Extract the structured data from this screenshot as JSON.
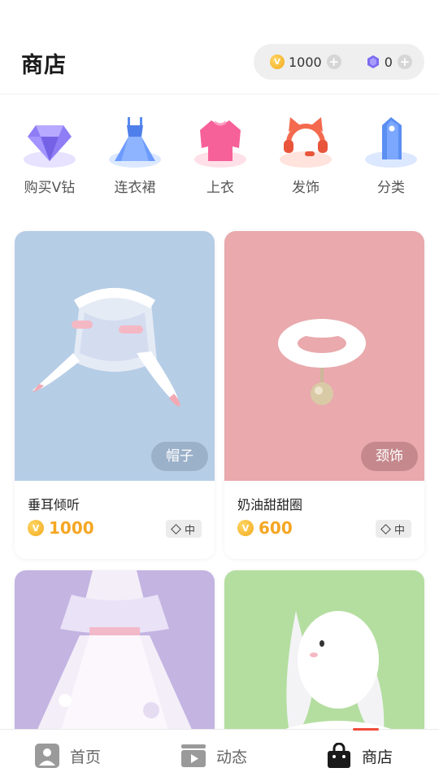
{
  "header": {
    "title": "商店",
    "coin_balance": "1000",
    "gem_balance": "0",
    "coin_symbol": "V"
  },
  "categories": [
    {
      "label": "购买V钻",
      "icon": "diamond-icon"
    },
    {
      "label": "连衣裙",
      "icon": "dress-icon"
    },
    {
      "label": "上衣",
      "icon": "shirt-icon"
    },
    {
      "label": "发饰",
      "icon": "cat-ear-headphones-icon"
    },
    {
      "label": "分类",
      "icon": "price-tag-icon"
    }
  ],
  "products": [
    {
      "name": "垂耳倾听",
      "price": "1000",
      "tag": "帽子",
      "size": "中",
      "bg": "#b6cde6",
      "icon": "bunny-ear-hat-image"
    },
    {
      "name": "奶油甜甜圈",
      "price": "600",
      "tag": "颈饰",
      "size": "中",
      "bg": "#e9a9ad",
      "icon": "fluffy-collar-image"
    },
    {
      "name": "",
      "price": "",
      "tag": "",
      "size": "",
      "bg": "#c3b4e2",
      "icon": "dress-image"
    },
    {
      "name": "",
      "price": "",
      "tag": "",
      "size": "",
      "bg": "#b4dea0",
      "icon": "bunny-plush-image"
    }
  ],
  "nav": [
    {
      "label": "首页",
      "icon": "home-icon",
      "active": false
    },
    {
      "label": "动态",
      "icon": "video-feed-icon",
      "active": false
    },
    {
      "label": "商店",
      "icon": "shopping-bag-icon",
      "active": true
    }
  ],
  "colors": {
    "accent": "#f5a623",
    "active_indicator": "#ef4b3d"
  }
}
